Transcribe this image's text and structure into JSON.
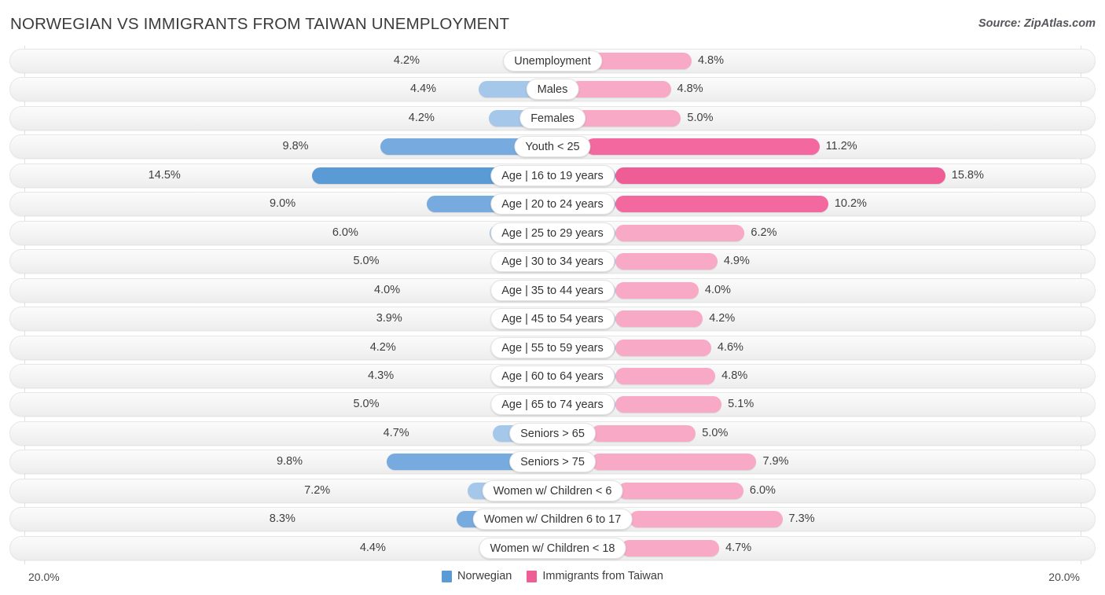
{
  "header": {
    "title": "NORWEGIAN VS IMMIGRANTS FROM TAIWAN UNEMPLOYMENT",
    "source": "Source: ZipAtlas.com"
  },
  "axis": {
    "left_max_label": "20.0%",
    "right_max_label": "20.0%",
    "max_value": 20.0
  },
  "legend": {
    "items": [
      {
        "label": "Norwegian",
        "color": "#5b9bd5"
      },
      {
        "label": "Immigrants from Taiwan",
        "color": "#ee5d96"
      }
    ]
  },
  "colors": {
    "left_light": "#a4c7ea",
    "left_mid": "#77aade",
    "left_dark": "#5b9bd5",
    "right_light": "#f7a9c6",
    "right_mid": "#f2689f",
    "right_dark": "#ee5d96",
    "title": "#3b3b3b",
    "track": "#f4f4f4"
  },
  "chart_data": {
    "type": "bar",
    "orientation": "horizontal-diverging",
    "title": "NORWEGIAN VS IMMIGRANTS FROM TAIWAN UNEMPLOYMENT",
    "xlabel": "",
    "ylabel": "",
    "xlim": [
      0,
      20.0
    ],
    "grid": true,
    "legend_position": "bottom-center",
    "categories": [
      "Unemployment",
      "Males",
      "Females",
      "Youth < 25",
      "Age | 16 to 19 years",
      "Age | 20 to 24 years",
      "Age | 25 to 29 years",
      "Age | 30 to 34 years",
      "Age | 35 to 44 years",
      "Age | 45 to 54 years",
      "Age | 55 to 59 years",
      "Age | 60 to 64 years",
      "Age | 65 to 74 years",
      "Seniors > 65",
      "Seniors > 75",
      "Women w/ Children < 6",
      "Women w/ Children 6 to 17",
      "Women w/ Children < 18"
    ],
    "series": [
      {
        "name": "Norwegian",
        "side": "left",
        "values": [
          4.2,
          4.4,
          4.2,
          9.8,
          14.5,
          9.0,
          6.0,
          5.0,
          4.0,
          3.9,
          4.2,
          4.3,
          5.0,
          4.7,
          9.8,
          7.2,
          8.3,
          4.4
        ],
        "labels": [
          "4.2%",
          "4.4%",
          "4.2%",
          "9.8%",
          "14.5%",
          "9.0%",
          "6.0%",
          "5.0%",
          "4.0%",
          "3.9%",
          "4.2%",
          "4.3%",
          "5.0%",
          "4.7%",
          "9.8%",
          "7.2%",
          "8.3%",
          "4.4%"
        ]
      },
      {
        "name": "Immigrants from Taiwan",
        "side": "right",
        "values": [
          4.8,
          4.8,
          5.0,
          11.2,
          15.8,
          10.2,
          6.2,
          4.9,
          4.0,
          4.2,
          4.6,
          4.8,
          5.1,
          5.0,
          7.9,
          6.0,
          7.3,
          4.7
        ],
        "labels": [
          "4.8%",
          "4.8%",
          "5.0%",
          "11.2%",
          "15.8%",
          "10.2%",
          "6.2%",
          "4.9%",
          "4.0%",
          "4.2%",
          "4.6%",
          "4.8%",
          "5.1%",
          "5.0%",
          "7.9%",
          "6.0%",
          "7.3%",
          "4.7%"
        ]
      }
    ]
  }
}
